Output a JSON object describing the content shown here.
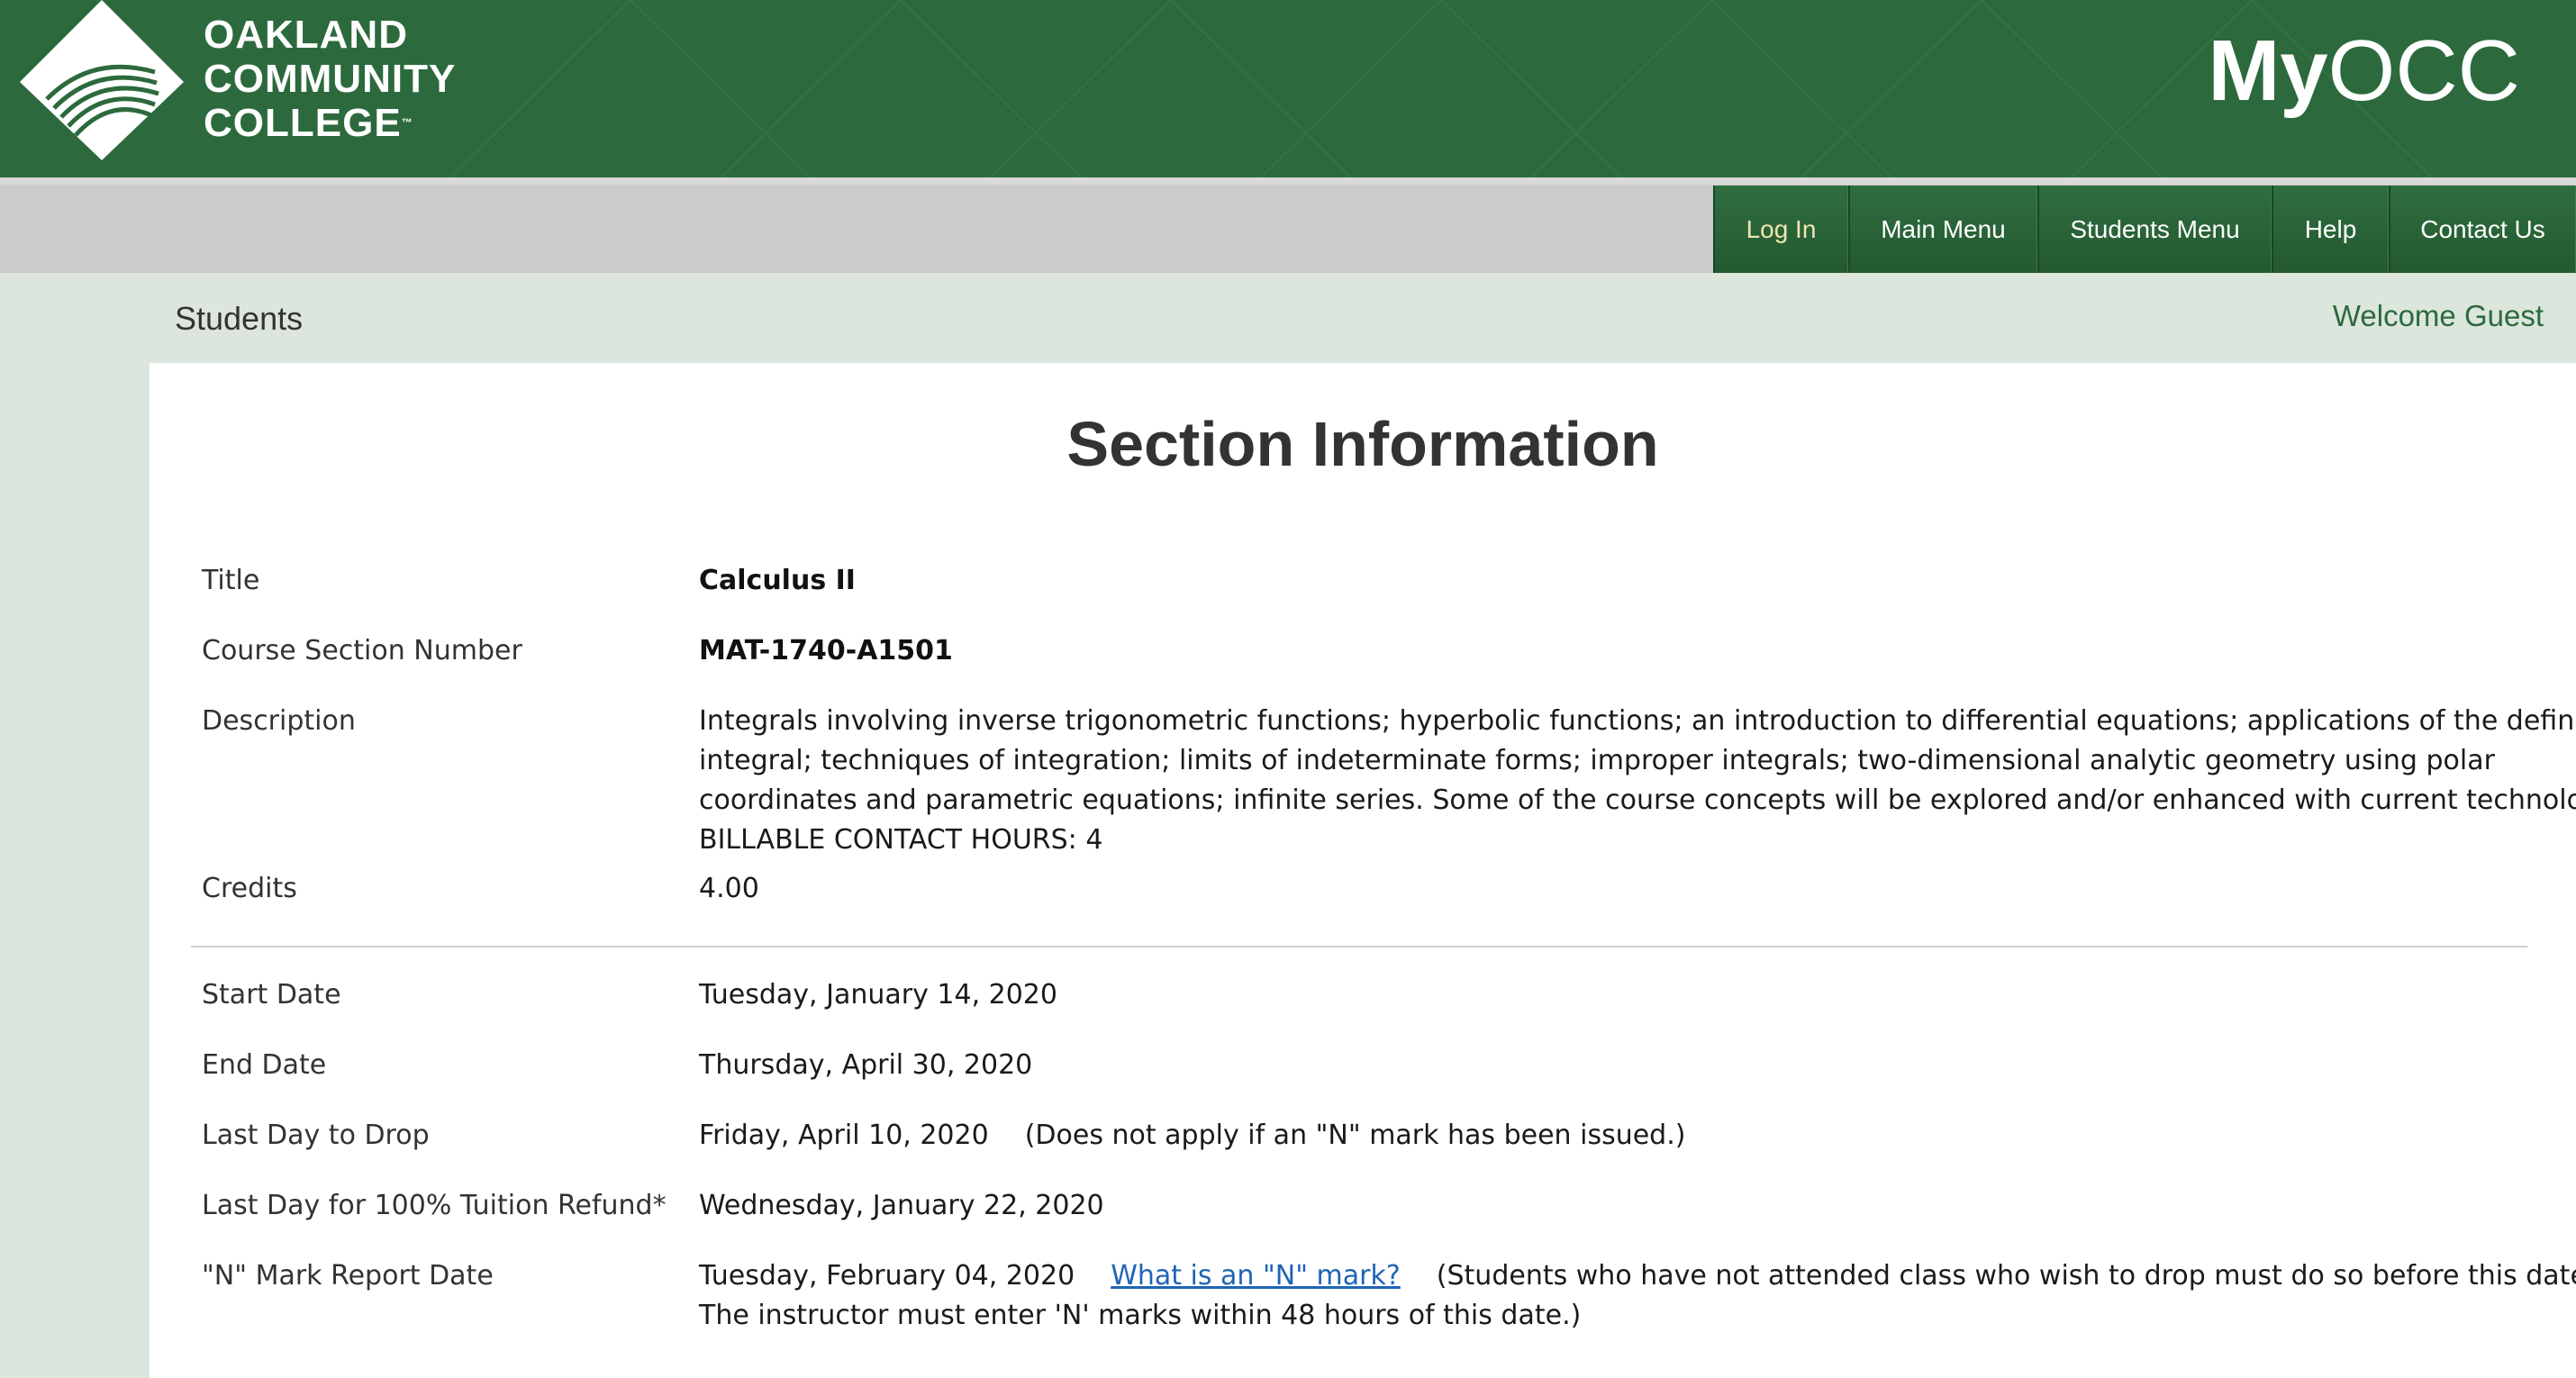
{
  "brand": {
    "logo_lines": [
      "OAKLAND",
      "COMMUNITY",
      "COLLEGE"
    ],
    "trademark": "™",
    "myocc_bold": "My",
    "myocc_regular": "OCC"
  },
  "nav": {
    "items": [
      {
        "label": "Log In"
      },
      {
        "label": "Main Menu"
      },
      {
        "label": "Students Menu"
      },
      {
        "label": "Help"
      },
      {
        "label": "Contact Us"
      }
    ]
  },
  "subheader": {
    "title": "Students",
    "welcome": "Welcome Guest"
  },
  "page": {
    "title": "Section Information"
  },
  "section": {
    "title_label": "Title",
    "title_value": "Calculus II",
    "number_label": "Course Section Number",
    "number_value": "MAT-1740-A1501",
    "description_label": "Description",
    "description_value": "Integrals involving inverse trigonometric functions; hyperbolic functions; an introduction to differential equations; applications of the definite integral; techniques of integration; limits of indeterminate forms; improper integrals; two-dimensional analytic geometry using polar coordinates and parametric equations; infinite series. Some of the course concepts will be explored and/or enhanced with current technology. BILLABLE CONTACT HOURS: 4",
    "credits_label": "Credits",
    "credits_value": "4.00"
  },
  "dates": {
    "start_label": "Start Date",
    "start_value": "Tuesday, January 14, 2020",
    "end_label": "End Date",
    "end_value": "Thursday, April 30, 2020",
    "drop_label": "Last Day to Drop",
    "drop_value": "Friday, April 10, 2020",
    "drop_note": "(Does not apply if an \"N\" mark has been issued.)",
    "refund_label": "Last Day for 100% Tuition Refund*",
    "refund_value": "Wednesday, January 22, 2020",
    "nmark_label": "\"N\" Mark Report Date",
    "nmark_value": "Tuesday, February 04, 2020",
    "nmark_link": "What is an \"N\" mark?",
    "nmark_note": "(Students who have not attended class who wish to drop must do so before this date. The instructor must enter 'N' marks within 48 hours of this date.)"
  },
  "colors": {
    "brand_green": "#2c6a3d",
    "nav_gray": "#cbcbcb",
    "page_bg": "#dce6dc",
    "link_blue": "#1f64b5"
  }
}
